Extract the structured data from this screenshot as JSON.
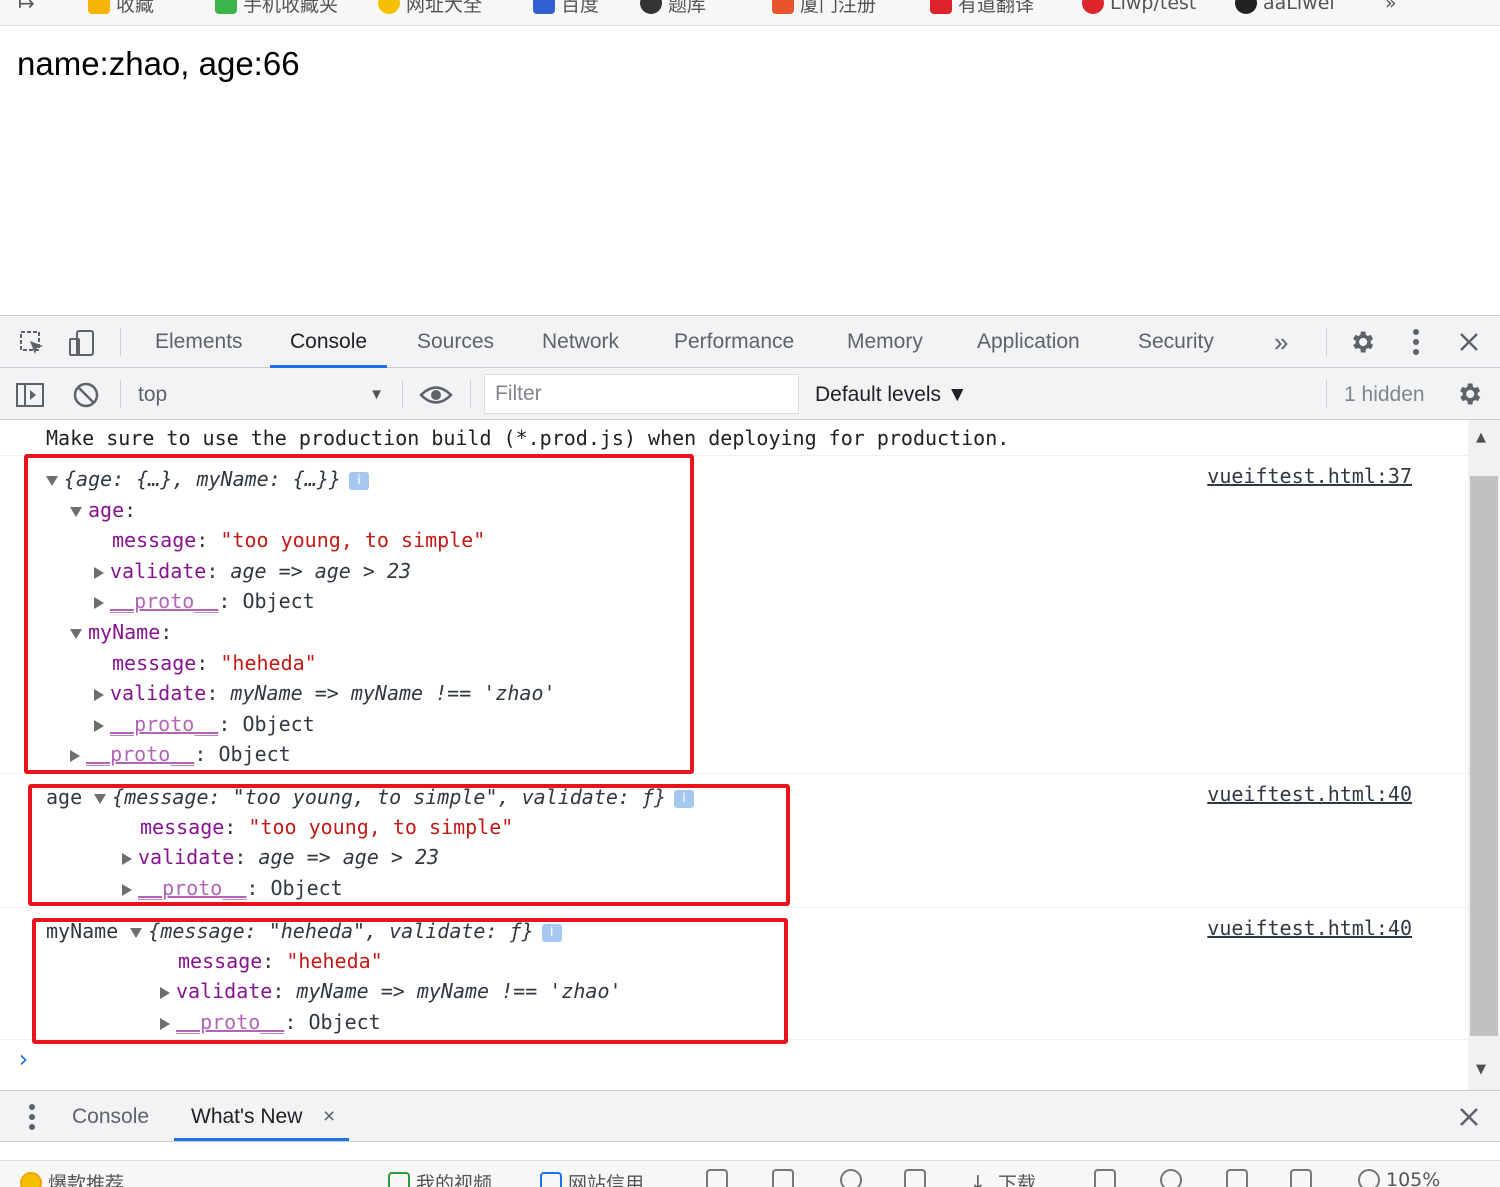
{
  "bookmarks": [
    {
      "label": "收藏",
      "color": "#f5b400"
    },
    {
      "label": "手机收藏夹",
      "color": "#3bb44a"
    },
    {
      "label": "网址大全",
      "color": "#f5c000"
    },
    {
      "label": "百度",
      "color": "#2f5fd0"
    },
    {
      "label": "题库",
      "color": "#333333"
    },
    {
      "label": "厦门注册",
      "color": "#e8552c"
    },
    {
      "label": "有道翻译",
      "color": "#e0242c"
    },
    {
      "label": "Liwp/test",
      "color": "#e0242c"
    },
    {
      "label": "aaLiwei",
      "color": "#222222"
    }
  ],
  "page": {
    "text": "name:zhao, age:66"
  },
  "devtools": {
    "tabs": [
      "Elements",
      "Console",
      "Sources",
      "Network",
      "Performance",
      "Memory",
      "Application",
      "Security"
    ],
    "active_tab": "Console",
    "more_tabs_glyph": "»",
    "toolbar": {
      "context": "top",
      "filter_placeholder": "Filter",
      "levels": "Default levels ▼",
      "hidden": "1 hidden"
    },
    "console": {
      "warning_line": "Make sure to use the production build (*.prod.js) when deploying for production.",
      "messages": [
        {
          "source": "vueiftest.html:37",
          "lines": {
            "l1": "{age: {…}, myName: {…}}",
            "l2_key": "age",
            "l3_key": "message",
            "l3_val": "\"too young, to simple\"",
            "l4_key": "validate",
            "l4_val": "age => age > 23",
            "l5_key": "__proto__",
            "l5_val": "Object",
            "l6_key": "myName",
            "l7_key": "message",
            "l7_val": "\"heheda\"",
            "l8_key": "validate",
            "l8_val": "myName => myName !== 'zhao'",
            "l9_key": "__proto__",
            "l9_val": "Object",
            "l10_key": "__proto__",
            "l10_val": "Object"
          }
        },
        {
          "source": "vueiftest.html:40",
          "prefix": "age",
          "summary_a": "{message: ",
          "summary_str": "\"too young, to simple\"",
          "summary_b": ", validate: ƒ}",
          "l2_key": "message",
          "l2_val": "\"too young, to simple\"",
          "l3_key": "validate",
          "l3_val": "age => age > 23",
          "l4_key": "__proto__",
          "l4_val": "Object"
        },
        {
          "source": "vueiftest.html:40",
          "prefix": "myName",
          "summary_a": "{message: ",
          "summary_str": "\"heheda\"",
          "summary_b": ", validate: ƒ}",
          "l2_key": "message",
          "l2_val": "\"heheda\"",
          "l3_key": "validate",
          "l3_val": "myName => myName !== 'zhao'",
          "l4_key": "__proto__",
          "l4_val": "Object"
        }
      ],
      "prompt": "›"
    },
    "drawer": {
      "tabs": [
        "Console",
        "What's New"
      ],
      "active": "What's New",
      "close_glyph": "×"
    }
  },
  "statusbar": {
    "left": "爆款推荐",
    "items": [
      "我的视频",
      "网站信用",
      "下载"
    ],
    "zoom": "105%"
  },
  "info_badge": "i"
}
